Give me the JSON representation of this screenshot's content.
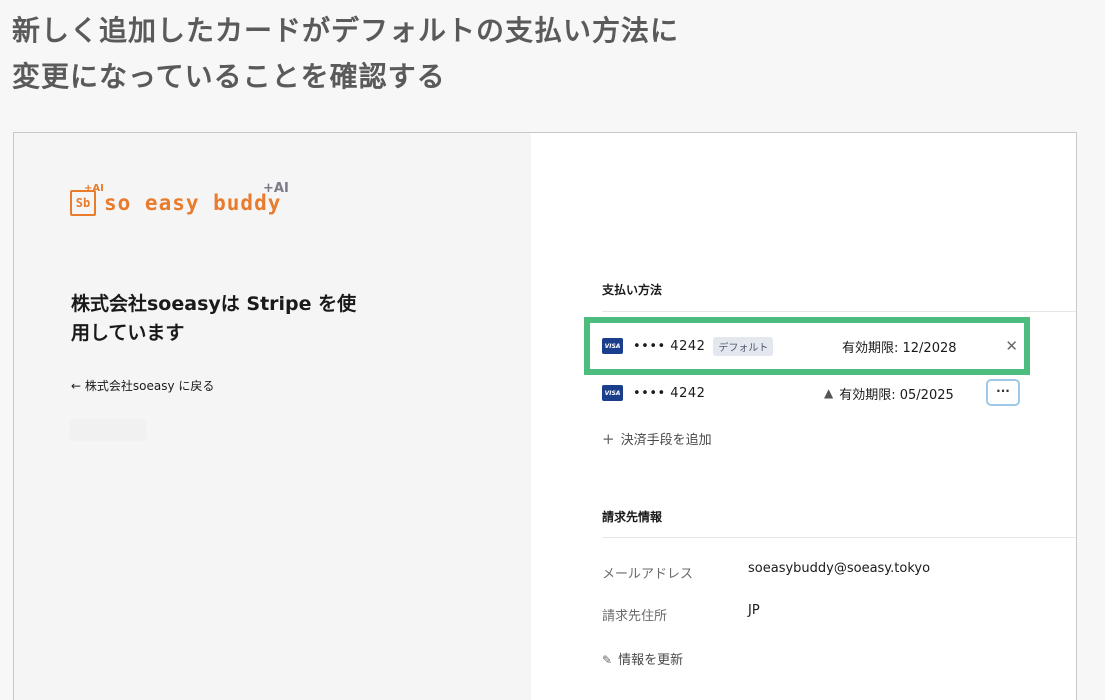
{
  "headline": {
    "line1": "新しく追加したカードがデフォルトの支払い方法に",
    "line2": "変更になっていることを確認する"
  },
  "logo": {
    "mark": "Sb",
    "mark_ai": "+AI",
    "text": "so easy buddy",
    "ai": "+AI",
    "color": "#e87b2c"
  },
  "merchant": {
    "heading": "株式会社soeasyは Stripe を使用しています",
    "back_link": "← 株式会社soeasy に戻る"
  },
  "payment_methods": {
    "title": "支払い方法",
    "cards": [
      {
        "brand": "VISA",
        "number": "•••• 4242",
        "badge": "デフォルト",
        "expiry": "有効期限: 12/2028",
        "action_icon": "close-icon",
        "highlighted": true
      },
      {
        "brand": "VISA",
        "number": "•••• 4242",
        "badge": "",
        "expiry": "有効期限: 05/2025",
        "warning_icon": "warning-icon",
        "action_icon": "more-icon",
        "highlighted": false
      }
    ],
    "add_label": "決済手段を追加",
    "highlight_color": "#4cbd7f"
  },
  "billing": {
    "title": "請求先情報",
    "email_label": "メールアドレス",
    "email_value": "soeasybuddy@soeasy.tokyo",
    "address_label": "請求先住所",
    "address_value": "JP",
    "update_label": "情報を更新"
  }
}
